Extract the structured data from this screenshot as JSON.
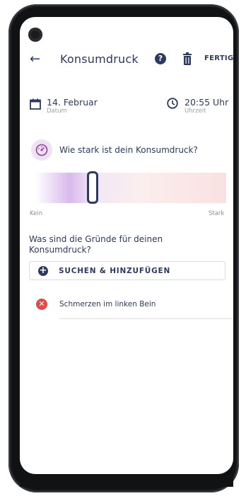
{
  "header": {
    "title": "Konsumdruck",
    "help_icon": "?",
    "done_label": "FERTIG"
  },
  "datetime": {
    "date_value": "14. Februar",
    "date_label": "Datum",
    "time_value": "20:55 Uhr",
    "time_label": "Uhrzeit"
  },
  "question": {
    "text": "Wie stark ist dein Konsumdruck?"
  },
  "slider": {
    "min_label": "Kein",
    "max_label": "Stark",
    "value_fraction": 0.3
  },
  "reasons": {
    "title": "Was sind die Gründe für deinen Konsumdruck?",
    "add_label": "SUCHEN & HINZUFÜGEN",
    "items": [
      {
        "label": "Schmerzen im linken Bein"
      }
    ]
  },
  "colors": {
    "primary": "#2d3a5f",
    "accent_purple": "#d9b9ec",
    "accent_pink": "#fae1e1",
    "danger": "#e04a4a"
  }
}
